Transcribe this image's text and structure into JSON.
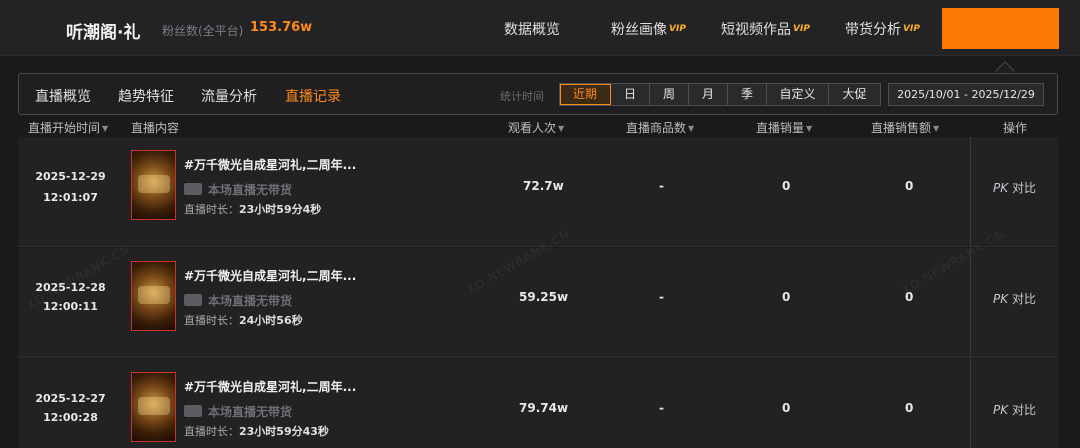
{
  "header": {
    "brand": "听潮阁·礼",
    "fans_label": "粉丝数(全平台)",
    "fans_value": "153.76w",
    "nav": [
      {
        "label": "数据概览",
        "vip": ""
      },
      {
        "label": "粉丝画像",
        "vip": "VIP"
      },
      {
        "label": "短视频作品",
        "vip": "VIP"
      },
      {
        "label": "带货分析",
        "vip": "VIP"
      }
    ],
    "accent_color": "#ff7a05"
  },
  "subnav": {
    "tabs": [
      "直播概览",
      "趋势特征",
      "流量分析",
      "直播记录"
    ],
    "active_tab": "直播记录",
    "stat_label": "统计时间",
    "periods": [
      "近期",
      "日",
      "周",
      "月",
      "季",
      "自定义",
      "大促"
    ],
    "active_period": "近期",
    "date_range": "2025/10/01  -  2025/12/29"
  },
  "table": {
    "columns": [
      "直播开始时间",
      "直播内容",
      "观看人次",
      "直播商品数",
      "直播销量",
      "直播销售额",
      "操作"
    ],
    "rows": [
      {
        "date": "2025-12-29",
        "time": "12:01:07",
        "title": "#万千微光自成星河礼,二周年...",
        "badge": "本场直播无带货",
        "duration_label": "直播时长：",
        "duration": "23小时59分4秒",
        "viewers": "72.7w",
        "products": "-",
        "sales": "0",
        "revenue": "0",
        "action_pk": "PK",
        "action_label": "对比"
      },
      {
        "date": "2025-12-28",
        "time": "12:00:11",
        "title": "#万千微光自成星河礼,二周年...",
        "badge": "本场直播无带货",
        "duration_label": "直播时长：",
        "duration": "24小时56秒",
        "viewers": "59.25w",
        "products": "-",
        "sales": "0",
        "revenue": "0",
        "action_pk": "PK",
        "action_label": "对比"
      },
      {
        "date": "2025-12-27",
        "time": "12:00:28",
        "title": "#万千微光自成星河礼,二周年...",
        "badge": "本场直播无带货",
        "duration_label": "直播时长：",
        "duration": "23小时59分43秒",
        "viewers": "79.74w",
        "products": "-",
        "sales": "0",
        "revenue": "0",
        "action_pk": "PK",
        "action_label": "对比"
      }
    ]
  },
  "watermark": "XD.NEWRANK.CN"
}
